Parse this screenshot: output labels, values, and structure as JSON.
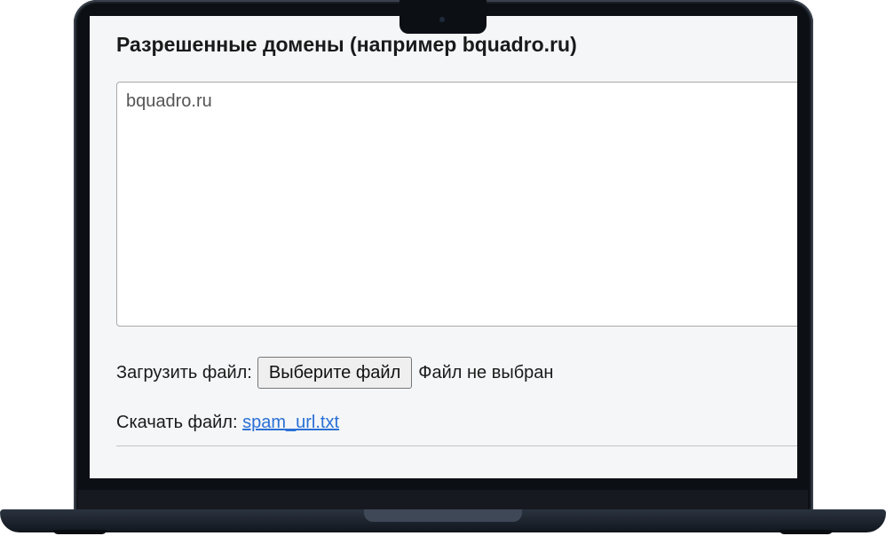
{
  "form": {
    "heading": "Разрешенные домены (например bquadro.ru)",
    "domains_value": "bquadro.ru",
    "upload_label": "Загрузить файл:",
    "choose_file_button": "Выберите файл",
    "no_file_text": "Файл не выбран",
    "download_label": "Скачать файл:",
    "download_link": "spam_url.txt"
  },
  "colors": {
    "link": "#2a6fd6",
    "screen_background": "#f4f6f7",
    "laptop_frame": "#0c0f14"
  },
  "icons": {
    "camera": "camera-icon"
  }
}
